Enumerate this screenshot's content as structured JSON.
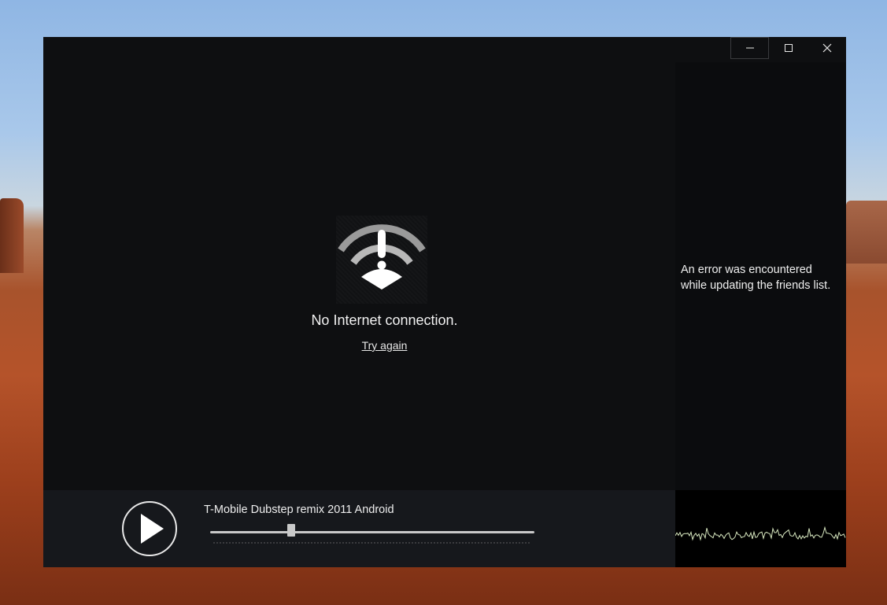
{
  "window": {
    "controls": {
      "minimize_icon": "minimize-icon",
      "maximize_icon": "maximize-icon",
      "close_icon": "close-icon"
    }
  },
  "main": {
    "status_icon": "wifi-error-icon",
    "message": "No Internet connection.",
    "retry_link": "Try again"
  },
  "friends_panel": {
    "error_line1": "An error was encountered",
    "error_line2": "while updating the friends list."
  },
  "player": {
    "play_icon": "play-icon",
    "track_title": "T-Mobile Dubstep remix 2011 Android",
    "progress": 0.25
  },
  "colors": {
    "window_bg": "#0e0f11",
    "player_bg": "#16181c",
    "waveform": "#d8e8c0"
  }
}
